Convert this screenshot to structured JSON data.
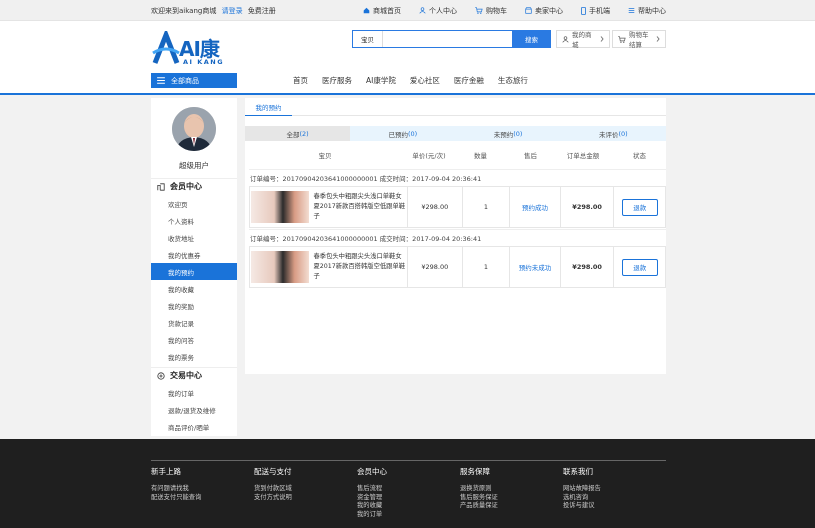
{
  "topbar": {
    "welcome": "欢迎来到aikang商城",
    "login": "请登录",
    "register": "免费注册",
    "links": [
      "商城首页",
      "个人中心",
      "购物车",
      "卖家中心",
      "手机端",
      "帮助中心"
    ]
  },
  "logo": {
    "main": "AI康",
    "sub": "AI KANG"
  },
  "search": {
    "category": "宝贝",
    "placeholder": "",
    "button": "搜索"
  },
  "header_buttons": {
    "my_mall": "我的商城",
    "cart_checkout": "购物车结算"
  },
  "all_goods": "全部商品",
  "nav": [
    "首页",
    "医疗服务",
    "AI康学院",
    "爱心社区",
    "医疗金融",
    "生态旅行"
  ],
  "sidebar": {
    "user_type": "超级用户",
    "member_center": "会员中心",
    "member_items": [
      "欢迎页",
      "个人资料",
      "收货地址",
      "我的优惠券",
      "我的预约",
      "我的收藏",
      "我的奖励",
      "货款记录",
      "我的问答",
      "我的票务"
    ],
    "active_item": "我的预约",
    "trade_center": "交易中心",
    "trade_items": [
      "我的订单",
      "退款/退货及维修",
      "商品评价/晒单"
    ]
  },
  "content": {
    "tab": "我的预约",
    "filters": [
      {
        "label": "全部",
        "count": "(2)"
      },
      {
        "label": "已预约",
        "count": "(0)"
      },
      {
        "label": "未预约",
        "count": "(0)"
      },
      {
        "label": "未评价",
        "count": "(0)"
      }
    ],
    "columns": [
      "宝贝",
      "单价(元/次)",
      "数量",
      "售后",
      "订单总金额",
      "状态"
    ],
    "orders": [
      {
        "header": "订单编号：20170904203641000000001 成交时间：2017-09-04 20:36:41",
        "name": "春季包头中粗跟尖头浅口单鞋女夏2017新款百搭韩版空低跟单鞋子",
        "price": "¥298.00",
        "qty": "1",
        "status": "预约成功",
        "total": "¥298.00",
        "action": "退款"
      },
      {
        "header": "订单编号：20170904203641000000001 成交时间：2017-09-04 20:36:41",
        "name": "春季包头中粗跟尖头浅口单鞋女夏2017新款百搭韩版空低跟单鞋子",
        "price": "¥298.00",
        "qty": "1",
        "status": "预约未成功",
        "total": "¥298.00",
        "action": "退款"
      }
    ]
  },
  "footer": {
    "columns": [
      {
        "title": "新手上路",
        "links": [
          "有问题请找我",
          "配送支付只能查询"
        ]
      },
      {
        "title": "配送与支付",
        "links": [
          "货到付款区域",
          "支付方式说明"
        ]
      },
      {
        "title": "会员中心",
        "links": [
          "售后流程",
          "资金管理",
          "我的收藏",
          "我的订单"
        ]
      },
      {
        "title": "服务保障",
        "links": [
          "退换货原则",
          "售后服务保证",
          "产品质量保证"
        ]
      },
      {
        "title": "联系我们",
        "links": [
          "网站故障报告",
          "选机咨询",
          "投诉与建议"
        ]
      }
    ]
  },
  "colors": {
    "accent": "#1a73d9",
    "footer_bg": "#1f1f1f"
  }
}
